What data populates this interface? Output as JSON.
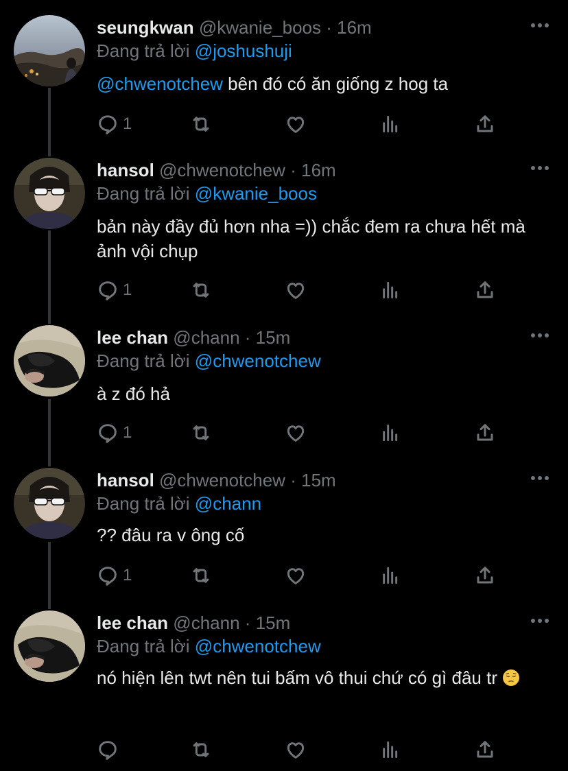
{
  "replying_prefix": "Đang trả lời",
  "icons": {
    "reply": "reply-icon",
    "retweet": "retweet-icon",
    "like": "heart-icon",
    "stats": "stats-icon",
    "share": "share-icon",
    "more": "more-icon"
  },
  "colors": {
    "background": "#000000",
    "mention": "#1d9bf0",
    "secondary_text": "#71767b",
    "thread_line": "#333639"
  },
  "tweets": [
    {
      "name": "seungkwan",
      "handle": "@kwanie_boos",
      "dot": "·",
      "time": "16m",
      "replying_to": "@joshushuji",
      "mention": "@chwenotchew",
      "text": " bên đó có ăn giống z hog ta",
      "reply_count": "1"
    },
    {
      "name": "hansol",
      "handle": "@chwenotchew",
      "dot": "·",
      "time": "16m",
      "replying_to": "@kwanie_boos",
      "text": "bản này đầy đủ hơn nha =)) chắc đem ra chưa hết mà ảnh vội chụp",
      "reply_count": "1"
    },
    {
      "name": "lee chan",
      "handle": "@chann",
      "dot": "·",
      "time": "15m",
      "replying_to": "@chwenotchew",
      "text": "à z đó hả",
      "reply_count": "1"
    },
    {
      "name": "hansol",
      "handle": "@chwenotchew",
      "dot": "·",
      "time": "15m",
      "replying_to": "@chann",
      "text": "?? đâu ra v ông cố",
      "reply_count": "1"
    },
    {
      "name": "lee chan",
      "handle": "@chann",
      "dot": "·",
      "time": "15m",
      "replying_to": "@chwenotchew",
      "text": "nó hiện lên twt nên tui bấm vô thui chứ có gì đâu tr",
      "emoji": "pensive-face-emoji",
      "reply_count": ""
    }
  ]
}
